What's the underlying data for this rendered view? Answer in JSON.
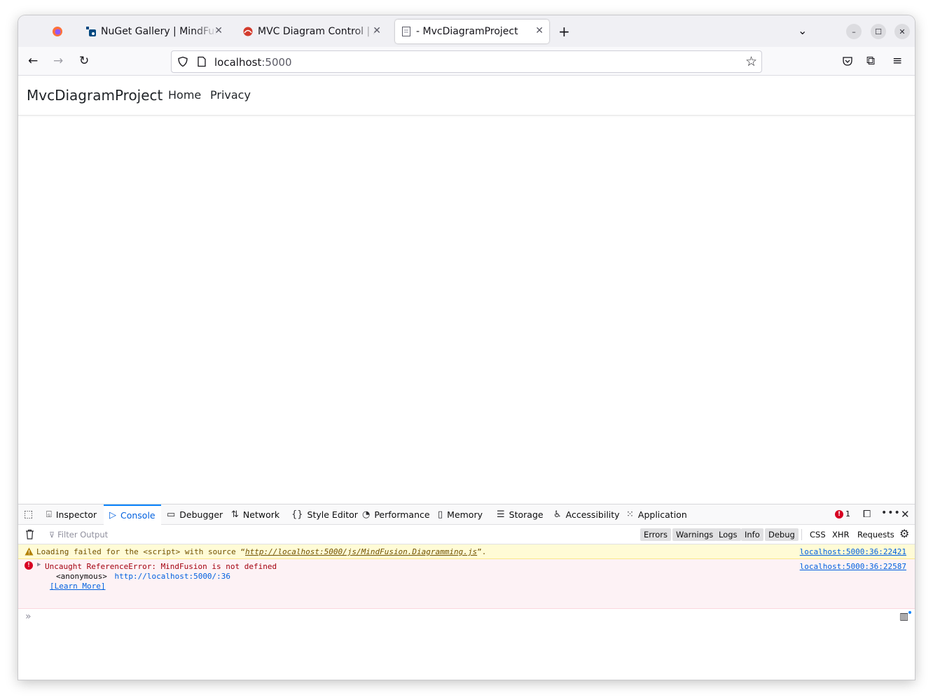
{
  "browser": {
    "tabs": [
      {
        "title": "NuGet Gallery | MindFusi",
        "active": false
      },
      {
        "title": "MVC Diagram Control | A",
        "active": false
      },
      {
        "title": "- MvcDiagramProject",
        "active": true
      }
    ],
    "url_host": "localhost",
    "url_port": ":5000"
  },
  "site": {
    "brand": "MvcDiagramProject",
    "nav": [
      "Home",
      "Privacy"
    ]
  },
  "devtools": {
    "tabs": [
      "Inspector",
      "Console",
      "Debugger",
      "Network",
      "Style Editor",
      "Performance",
      "Memory",
      "Storage",
      "Accessibility",
      "Application"
    ],
    "active_tab": "Console",
    "error_count": "1",
    "filter_placeholder": "Filter Output",
    "filters": [
      "Errors",
      "Warnings",
      "Logs",
      "Info",
      "Debug"
    ],
    "filters_plain": [
      "CSS",
      "XHR",
      "Requests"
    ],
    "messages": [
      {
        "level": "warning",
        "prefix": "Loading failed for the <script> with source “",
        "link": "http://localhost:5000/js/MindFusion.Diagramming.js",
        "suffix": "”.",
        "location": "localhost:5000:36:22421"
      },
      {
        "level": "error",
        "text": "Uncaught ReferenceError: MindFusion is not defined",
        "stack_fn": "<anonymous>",
        "stack_loc": "http://localhost:5000/:36",
        "learn_more": "[Learn More]",
        "location": "localhost:5000:36:22587"
      }
    ]
  },
  "colors": {
    "accent": "#0060df",
    "error": "#a4000f",
    "warning": "#715100"
  }
}
